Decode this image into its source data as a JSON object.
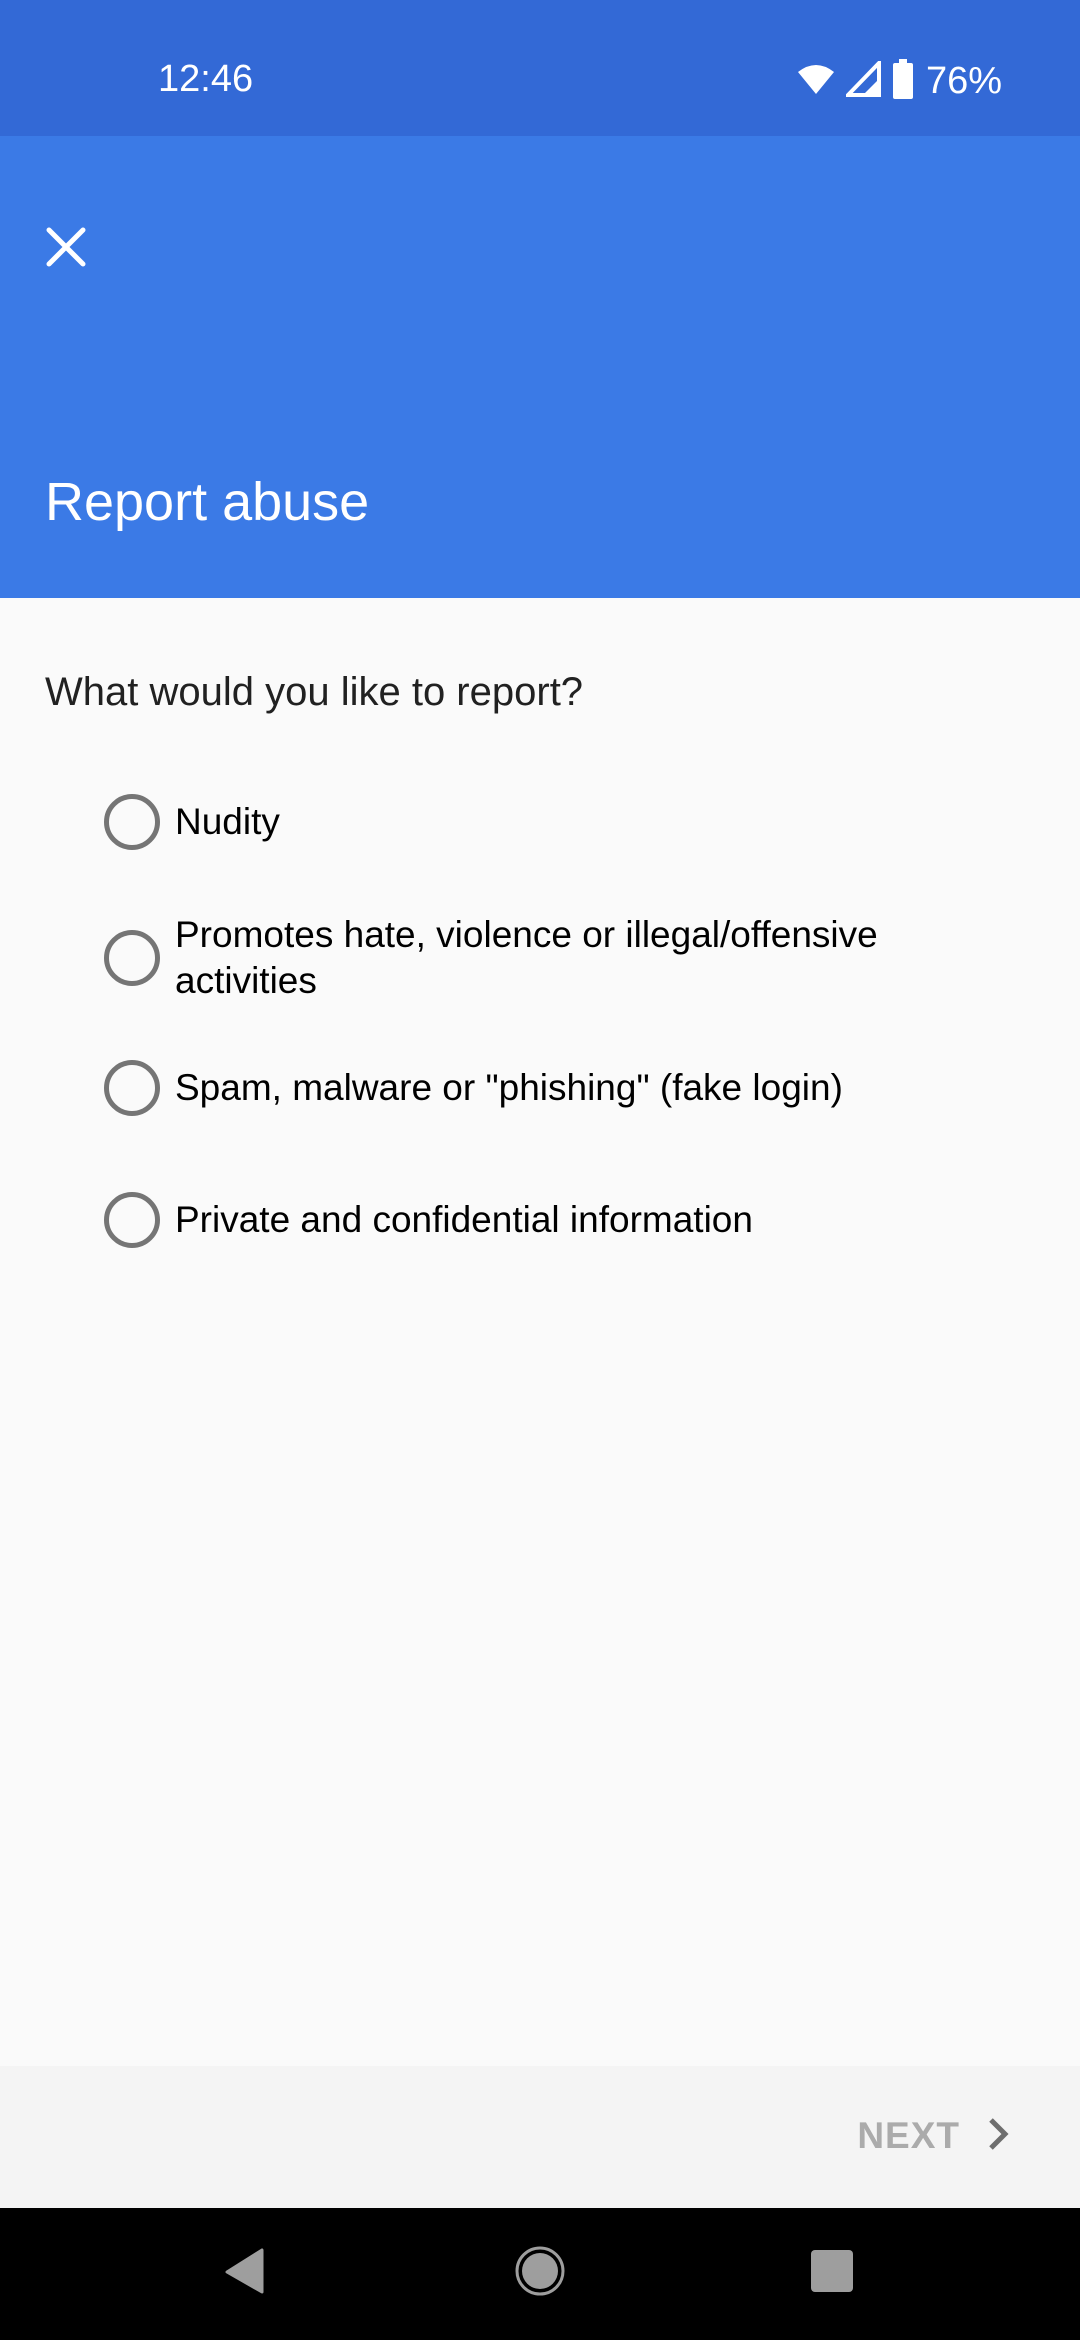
{
  "status_bar": {
    "time": "12:46",
    "battery_percent": "76%",
    "icons": [
      "wifi-icon",
      "cell-signal-icon",
      "battery-icon"
    ]
  },
  "header": {
    "close_icon": "close-icon",
    "title": "Report abuse",
    "background_color": "#3b7ae6",
    "status_bar_color": "#3369d6"
  },
  "form": {
    "question": "What would you like to report?",
    "options": [
      {
        "label": "Nudity",
        "selected": false
      },
      {
        "label": "Promotes hate, violence or illegal/offensive activities",
        "selected": false
      },
      {
        "label": "Spam, malware or \"phishing\" (fake login)",
        "selected": false
      },
      {
        "label": "Private and confidential information",
        "selected": false
      }
    ]
  },
  "footer": {
    "next_label": "NEXT",
    "next_icon": "chevron-right-icon",
    "next_enabled": false
  },
  "nav_bar": {
    "buttons": [
      "back",
      "home",
      "recents"
    ]
  }
}
